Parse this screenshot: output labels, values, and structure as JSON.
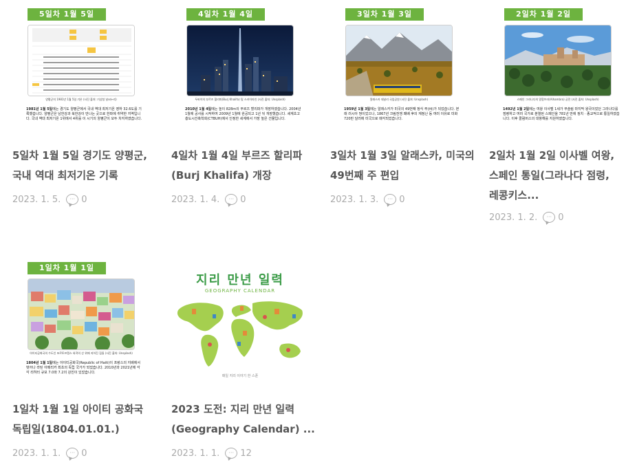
{
  "cards": [
    {
      "badge": "5일차 1월 5일",
      "caption": "양평군의 1981년 1월 5일 기온 (사진 출처: 기상청 날씨누리)",
      "body_date": "1981년 1월 5일",
      "body_text": "에는 경기도 양평군에서 국내 역대 최저기온 영하 32.6도를 기록했습니다. 양평군은 남한강과 북한강이 만나는 곳으로 한파에 취약한 지역입니다. 국내 역대 최저기온 1위에서 4위를 이 시기의 양평군이 모두 차지하였습니다.",
      "title": "5일차 1월 5일 경기도 양평군, 국내 역대 최저기온 기록",
      "date": "2023. 1. 5.",
      "comments": "0"
    },
    {
      "badge": "4일차 1월 4일",
      "caption": "두바이의 부르즈 할리파(Burj Khalifa) 및 스카이라인 (사진 출처: Unsplash)",
      "body_date": "2010년 1월 4일",
      "body_text": "에는 높이 828m의 부르즈 할리파가 개장하였습니다. 2004년 1월에 공사를 시작하여 2009년 1월에 완공되고 1년 뒤 개장했습니다. 세계초고층도시건축학회(CTBUH)에서 인정한 세계에서 가장 높은 건물입니다.",
      "title": "4일차 1월 4일 부르즈 할리파(Burj Khalifa) 개장",
      "date": "2023. 1. 4.",
      "comments": "0"
    },
    {
      "badge": "3일차 1월 3일",
      "caption": "알래스카 데날리 국립공원 (사진 출처: Unsplash)",
      "body_date": "1959년 1월 3일",
      "body_text": "에는 알래스카가 미국의 49번째 정식 주(州)가 되었습니다. 본래 러시아 땅이었으나, 1867년 크림전쟁 패배 후의 재정난 등 여러 이유로 미화 720만 달러에 미국으로 매각되었습니다.",
      "title": "3일차 1월 3일 알래스카, 미국의 49번째 주 편입",
      "date": "2023. 1. 3.",
      "comments": "0"
    },
    {
      "badge": "2일차 1월 2일",
      "caption": "스페인 그라나다의 알함브라(Alhambra) 궁전 (사진 출처: Unsplash)",
      "body_date": "1492년 1월 2일",
      "body_text": "에는 여왕 이사벨 1세가 무슬림 마지막 왕국이었던 그라나다를 점령하고 여러 국가로 분열된 스페인을 781년 만에 정치 · 종교적으로 통일하였습니다. 이후 콜럼버스의 대항해를 지원하였습니다.",
      "title": "2일차 1월 2일 이사벨 여왕, 스페인 통일(그라나다 점령, 레콩키스...",
      "date": "2023. 1. 2.",
      "comments": "0"
    },
    {
      "badge": "1일차 1월 1일",
      "caption": "아이티공화국의 수도인 포르토프랭스 외곽의 산 위에 지어진 집들 (사진 출처: Unsplash)",
      "body_date": "1804년 1월 1일",
      "body_text": "에는 아이티공화국(Republic of Haiti)이 프랑스의 지배에서 벗어나 라틴 아메리카 최초의 독립 국가가 되었습니다. 2010년과 2021년에 각각 리히터 규모 7.0와 7.2의 강진이 있었습니다.",
      "title": "1일차 1월 1일 아이티 공화국 독립일(1804.01.01.)",
      "date": "2023. 1. 1.",
      "comments": "0"
    },
    {
      "cal_title": "지리 만년 일력",
      "cal_sub": "GEOGRAPHY CALENDAR",
      "cal_foot": "매일 지리 이야기 한 스푼",
      "title": "2023 도전: 지리 만년 일력 (Geography Calendar) ...",
      "date": "2023. 1. 1.",
      "comments": "12"
    }
  ],
  "colors": {
    "badge": "#6db33f",
    "title": "#555555",
    "meta": "#aaaaaa",
    "accent": "#3a9b46"
  },
  "icons": {
    "comment": "comment-bubble-icon"
  }
}
